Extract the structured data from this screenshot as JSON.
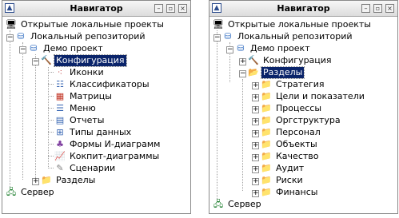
{
  "left": {
    "title": "Навигатор",
    "nodes": [
      {
        "label": "Открытые локальные проекты",
        "icon": "computer-icon"
      },
      {
        "label": "Локальный репозиторий",
        "icon": "database-icon"
      },
      {
        "label": "Демо проект",
        "icon": "database-icon"
      },
      {
        "label": "Конфигурация",
        "icon": "hammer-icon",
        "selected": true
      },
      {
        "label": "Иконки",
        "icon": "icons-icon"
      },
      {
        "label": "Классификаторы",
        "icon": "classifiers-icon"
      },
      {
        "label": "Матрицы",
        "icon": "matrix-icon"
      },
      {
        "label": "Меню",
        "icon": "menu-icon"
      },
      {
        "label": "Отчеты",
        "icon": "report-icon"
      },
      {
        "label": "Типы данных",
        "icon": "data-types-icon"
      },
      {
        "label": "Формы И-диаграмм",
        "icon": "diagram-form-icon"
      },
      {
        "label": "Кокпит-диаграммы",
        "icon": "cockpit-chart-icon"
      },
      {
        "label": "Сценарии",
        "icon": "scenario-icon"
      },
      {
        "label": "Разделы",
        "icon": "folder-icon"
      },
      {
        "label": "Сервер",
        "icon": "server-icon"
      }
    ]
  },
  "right": {
    "title": "Навигатор",
    "nodes": [
      {
        "label": "Открытые локальные проекты",
        "icon": "computer-icon"
      },
      {
        "label": "Локальный репозиторий",
        "icon": "database-icon"
      },
      {
        "label": "Демо проект",
        "icon": "database-icon"
      },
      {
        "label": "Конфигурация",
        "icon": "hammer-icon"
      },
      {
        "label": "Разделы",
        "icon": "folder-icon",
        "selected": true
      },
      {
        "label": "Стратегия",
        "icon": "folder-icon"
      },
      {
        "label": "Цели и показатели",
        "icon": "folder-icon"
      },
      {
        "label": "Процессы",
        "icon": "folder-icon"
      },
      {
        "label": "Оргструктура",
        "icon": "folder-icon"
      },
      {
        "label": "Персонал",
        "icon": "folder-icon"
      },
      {
        "label": "Объекты",
        "icon": "folder-icon"
      },
      {
        "label": "Качество",
        "icon": "folder-icon"
      },
      {
        "label": "Аудит",
        "icon": "folder-icon"
      },
      {
        "label": "Риски",
        "icon": "folder-icon"
      },
      {
        "label": "Финансы",
        "icon": "folder-icon"
      },
      {
        "label": "Сервер",
        "icon": "server-icon"
      }
    ]
  },
  "colors": {
    "selection": "#0a246a",
    "folder": "#e2b53a"
  }
}
